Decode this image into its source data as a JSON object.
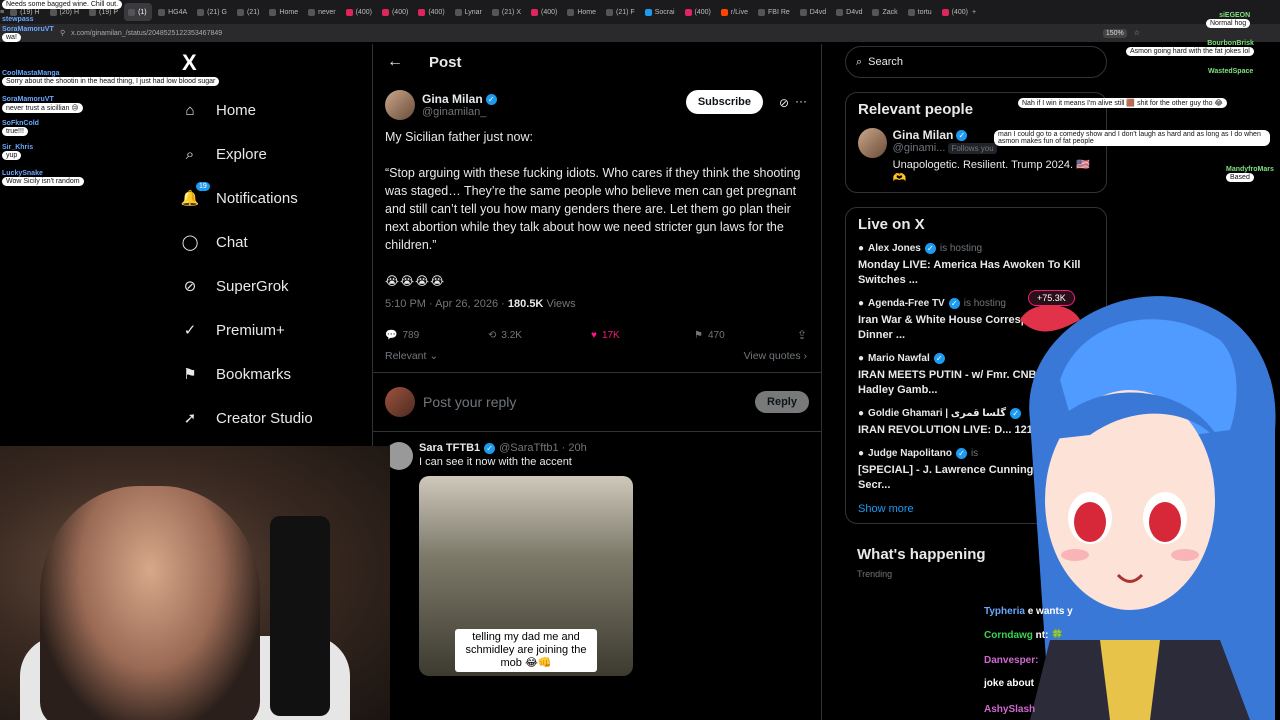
{
  "browser": {
    "tabs": [
      {
        "label": "(19) H",
        "color": "#555"
      },
      {
        "label": "(20) H",
        "color": "#555"
      },
      {
        "label": "(19) P",
        "color": "#555"
      },
      {
        "label": "(1) ",
        "color": "#555",
        "active": true
      },
      {
        "label": "HG4A",
        "color": "#555"
      },
      {
        "label": "(21) G",
        "color": "#555"
      },
      {
        "label": "(21) ",
        "color": "#555"
      },
      {
        "label": "Home",
        "color": "#555"
      },
      {
        "label": "never",
        "color": "#555"
      },
      {
        "label": "(400)",
        "color": "#e0245e"
      },
      {
        "label": "(400)",
        "color": "#e0245e"
      },
      {
        "label": "(400)",
        "color": "#e0245e"
      },
      {
        "label": "Lynar",
        "color": "#555"
      },
      {
        "label": "(21) X",
        "color": "#555"
      },
      {
        "label": "(400)",
        "color": "#e0245e"
      },
      {
        "label": "Home",
        "color": "#555"
      },
      {
        "label": "(21) F",
        "color": "#555"
      },
      {
        "label": "Socrai",
        "color": "#1d9bf0"
      },
      {
        "label": "(400)",
        "color": "#e0245e"
      },
      {
        "label": "r/Live",
        "color": "#ff4500"
      },
      {
        "label": "FBI Re",
        "color": "#555"
      },
      {
        "label": "D4vd",
        "color": "#555"
      },
      {
        "label": "D4vd",
        "color": "#555"
      },
      {
        "label": "Zack",
        "color": "#555"
      },
      {
        "label": "tortu",
        "color": "#555"
      },
      {
        "label": "(400)",
        "color": "#e0245e"
      }
    ],
    "url": "x.com/ginamilan_/status/2048525122353467849",
    "zoom": "150%"
  },
  "nav": {
    "logo": "X",
    "items": [
      {
        "label": "Home",
        "icon": "home-icon"
      },
      {
        "label": "Explore",
        "icon": "search-icon"
      },
      {
        "label": "Notifications",
        "icon": "bell-icon",
        "badge": "19"
      },
      {
        "label": "Chat",
        "icon": "chat-icon"
      },
      {
        "label": "SuperGrok",
        "icon": "grok-icon"
      },
      {
        "label": "Premium+",
        "icon": "premium-icon"
      },
      {
        "label": "Bookmarks",
        "icon": "bookmark-icon"
      },
      {
        "label": "Creator Studio",
        "icon": "rocket-icon"
      }
    ]
  },
  "post": {
    "header": "Post",
    "author_name": "Gina Milan",
    "author_handle": "@ginamilan_",
    "subscribe": "Subscribe",
    "intro": "My Sicilian father just now:",
    "quote": "“Stop arguing with these fucking idiots. Who cares if they think the shooting was staged… They’re the same people who believe men can get pregnant and still can’t tell you how many genders there are. Let them go plan their next abortion while they talk about how we need stricter gun laws for the children.”",
    "emojis": "😭😭😭😭",
    "time": "5:10 PM · Apr 26, 2026 · ",
    "views": "180.5K",
    "views_label": " Views",
    "replies": "789",
    "reposts": "3.2K",
    "likes": "17K",
    "bookmarks": "470",
    "sort": "Relevant ⌄",
    "view_quotes": "View quotes ›",
    "reply_placeholder": "Post your reply",
    "reply_button": "Reply"
  },
  "comment": {
    "name": "Sara TFTB1",
    "handle": "@SaraTftb1 · 20h",
    "text": "I can see it now with the accent",
    "caption": "telling my dad me and schmidley are joining the mob 😂👊"
  },
  "right": {
    "search_placeholder": "Search",
    "relevant_title": "Relevant people",
    "rp_name": "Gina Milan",
    "rp_handle": "@ginami...",
    "rp_follows": "Follows you",
    "rp_bio": "Unapologetic. Resilient. Trump 2024. 🇺🇸🫶",
    "live_title": "Live on X",
    "live": [
      {
        "host": "Alex Jones",
        "is": "is hosting",
        "title": "Monday LIVE: America Has Awoken To Kill Switches ..."
      },
      {
        "host": "Agenda-Free TV",
        "is": "is hosting",
        "title": "Iran War & White House Correspondents' Dinner ..."
      },
      {
        "host": "Mario Nawfal",
        "is": "",
        "title": "IRAN MEETS PUTIN - w/ Fmr. CNBC Anchor Hadley Gamb..."
      },
      {
        "host": "Goldie Ghamari | گلسا قمری",
        "is": "",
        "title": "IRAN REVOLUTION LIVE: D... 121"
      },
      {
        "host": "Judge Napolitano",
        "is": "is",
        "title": "[SPECIAL] - J. Lawrence Cunningham , Fmr. Secr..."
      }
    ],
    "live_count": "+75.3K",
    "show_more": "Show more",
    "whats": "What's happening",
    "trending": "Trending"
  },
  "chat_left": [
    {
      "user": "",
      "msg": "Needs some bagged wine. Chill out."
    },
    {
      "user": "stewpass",
      "msg": ""
    },
    {
      "user": "SoraMamoruVT",
      "msg": "wa!"
    },
    {
      "user": "CoolMastaManga",
      "msg": "Sorry about the shootin in the head thing, I just had low blood sugar"
    },
    {
      "user": "SoraMamoruVT",
      "msg": "never trust a sicillian 😢"
    },
    {
      "user": "SoFknCold",
      "msg": "true!!!"
    },
    {
      "user": "Sir_Khris",
      "msg": "yup"
    },
    {
      "user": "LuckySnake",
      "msg": "Wow Sicily isn't random"
    }
  ],
  "chat_right": [
    {
      "user": "siEGEON",
      "msg": "Normal hog"
    },
    {
      "user": "BourbonBrisk",
      "msg": "Asmon going hard with the fat jokes lol"
    },
    {
      "user": "WastedSpace",
      "msg": ""
    },
    {
      "user": "",
      "msg": "Nah if I win it means I'm alive still 🟫 shit for the other guy tho 😂"
    },
    {
      "user": "",
      "msg": "man I could go to a comedy show and I don't laugh as hard and as long as I do when asmon makes fun of fat people"
    },
    {
      "user": "MandyfroMars",
      "msg": "Based"
    }
  ],
  "chat_bottom": [
    {
      "user": "Typheria",
      "msg": "e wants y",
      "color": "#6aa7ff"
    },
    {
      "user": "Corndawg",
      "msg": "nt: 🍀",
      "color": "#39d353"
    },
    {
      "user": "Danvesper:",
      "msg": "",
      "color": "#d06ad0"
    },
    {
      "user": "",
      "msg": "joke about",
      "color": "#fff"
    },
    {
      "user": "AshySlash",
      "msg": "",
      "color": "#d06ad0"
    }
  ]
}
